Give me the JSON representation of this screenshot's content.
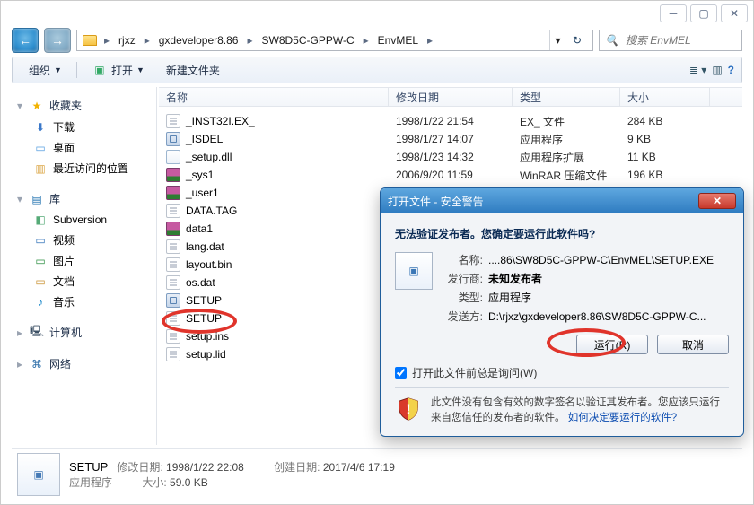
{
  "breadcrumb": [
    "rjxz",
    "gxdeveloper8.86",
    "SW8D5C-GPPW-C",
    "EnvMEL"
  ],
  "search": {
    "placeholder": "搜索 EnvMEL"
  },
  "toolbar": {
    "organize": "组织",
    "open": "打开",
    "new_folder": "新建文件夹"
  },
  "columns": {
    "name": "名称",
    "date": "修改日期",
    "type": "类型",
    "size": "大小"
  },
  "nav": {
    "favorites": "收藏夹",
    "downloads": "下载",
    "desktop": "桌面",
    "recent": "最近访问的位置",
    "libraries": "库",
    "subversion": "Subversion",
    "videos": "视频",
    "pictures": "图片",
    "docs": "文档",
    "music": "音乐",
    "computer": "计算机",
    "network": "网络"
  },
  "files": [
    {
      "name": "_INST32I.EX_",
      "ico": "generic",
      "date": "1998/1/22 21:54",
      "type": "EX_ 文件",
      "size": "284 KB"
    },
    {
      "name": "_ISDEL",
      "ico": "exe",
      "date": "1998/1/27 14:07",
      "type": "应用程序",
      "size": "9 KB"
    },
    {
      "name": "_setup.dll",
      "ico": "dll",
      "date": "1998/1/23 14:32",
      "type": "应用程序扩展",
      "size": "11 KB"
    },
    {
      "name": "_sys1",
      "ico": "rar",
      "date": "2006/9/20 11:59",
      "type": "WinRAR 压缩文件",
      "size": "196 KB"
    },
    {
      "name": "_user1",
      "ico": "rar",
      "date": "",
      "type": "",
      "size": ""
    },
    {
      "name": "DATA.TAG",
      "ico": "generic",
      "date": "",
      "type": "",
      "size": ""
    },
    {
      "name": "data1",
      "ico": "rar",
      "date": "",
      "type": "",
      "size": ""
    },
    {
      "name": "lang.dat",
      "ico": "generic",
      "date": "",
      "type": "",
      "size": ""
    },
    {
      "name": "layout.bin",
      "ico": "generic",
      "date": "",
      "type": "",
      "size": ""
    },
    {
      "name": "os.dat",
      "ico": "generic",
      "date": "",
      "type": "",
      "size": ""
    },
    {
      "name": "SETUP",
      "ico": "exe",
      "date": "",
      "type": "",
      "size": ""
    },
    {
      "name": "SETUP",
      "ico": "generic",
      "date": "",
      "type": "",
      "size": ""
    },
    {
      "name": "setup.ins",
      "ico": "generic",
      "date": "",
      "type": "",
      "size": ""
    },
    {
      "name": "setup.lid",
      "ico": "generic",
      "date": "",
      "type": "",
      "size": ""
    }
  ],
  "details": {
    "title": "SETUP",
    "subtitle": "应用程序",
    "mod_label": "修改日期:",
    "mod_value": "1998/1/22 22:08",
    "create_label": "创建日期:",
    "create_value": "2017/4/6 17:19",
    "size_label": "大小:",
    "size_value": "59.0 KB"
  },
  "dialog": {
    "title": "打开文件 - 安全警告",
    "warn": "无法验证发布者。您确定要运行此软件吗?",
    "name_label": "名称:",
    "name_value": "....86\\SW8D5C-GPPW-C\\EnvMEL\\SETUP.EXE",
    "pub_label": "发行商:",
    "pub_value": "未知发布者",
    "type_label": "类型:",
    "type_value": "应用程序",
    "from_label": "发送方:",
    "from_value": "D:\\rjxz\\gxdeveloper8.86\\SW8D5C-GPPW-C...",
    "run": "运行(R)",
    "cancel": "取消",
    "ask": "打开此文件前总是询问(W)",
    "footer_text_a": "此文件没有包含有效的数字签名以验证其发布者。您应该只运行来自您信任的发布者的软件。",
    "footer_link": "如何决定要运行的软件?"
  }
}
